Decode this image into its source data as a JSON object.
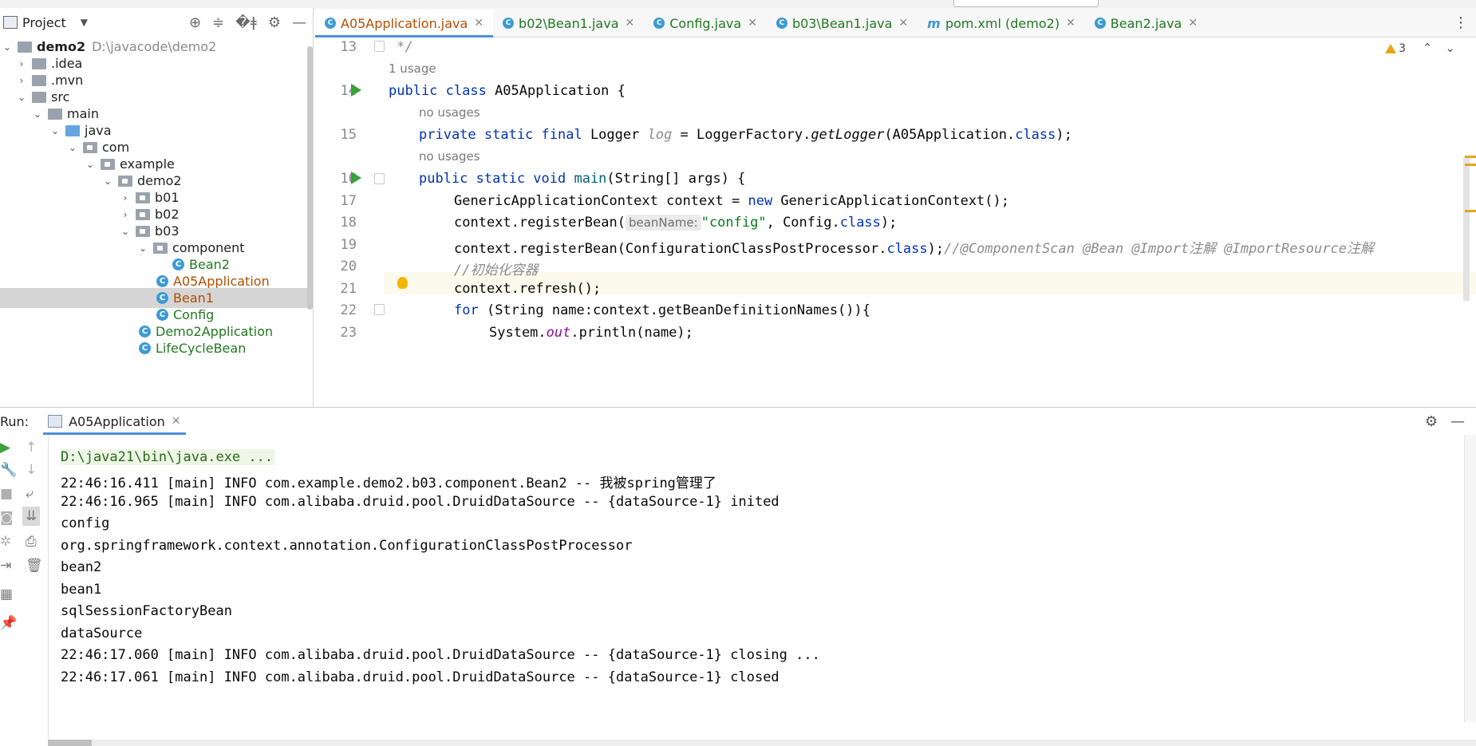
{
  "project": {
    "title": "Project",
    "tree": [
      {
        "label": "demo2",
        "path": "D:\\javacode\\demo2",
        "bold": true
      },
      {
        "label": ".idea"
      },
      {
        "label": ".mvn"
      },
      {
        "label": "src"
      },
      {
        "label": "main"
      },
      {
        "label": "java"
      },
      {
        "label": "com"
      },
      {
        "label": "example"
      },
      {
        "label": "demo2"
      },
      {
        "label": "b01"
      },
      {
        "label": "b02"
      },
      {
        "label": "b03"
      },
      {
        "label": "component"
      },
      {
        "label": "Bean2"
      },
      {
        "label": "A05Application"
      },
      {
        "label": "Bean1"
      },
      {
        "label": "Config"
      },
      {
        "label": "Demo2Application"
      },
      {
        "label": "LifeCycleBean"
      }
    ]
  },
  "tabs": [
    {
      "label": "A05Application.java"
    },
    {
      "label": "b02\\Bean1.java"
    },
    {
      "label": "Config.java"
    },
    {
      "label": "b03\\Bean1.java"
    },
    {
      "label": "pom.xml (demo2)"
    },
    {
      "label": "Bean2.java"
    }
  ],
  "editor": {
    "warning_count": "3",
    "line_numbers": [
      "13",
      "14",
      "15",
      "16",
      "17",
      "18",
      "19",
      "20",
      "21",
      "22",
      "23"
    ],
    "hints": {
      "h1": "1 usage",
      "h2": "no usages",
      "h3": "no usages"
    },
    "code": {
      "l13": " */",
      "l14_kw": "public class ",
      "l14_rest": "A05Application {",
      "l15_kw": "private static final ",
      "l15_a": "Logger ",
      "l15_field": "log",
      "l15_b": " = LoggerFactory.",
      "l15_fn": "getLogger",
      "l15_c": "(A05Application.",
      "l15_kw2": "class",
      "l15_d": ");",
      "l16_kw": "public static void ",
      "l16_fn": "main",
      "l16_rest": "(String[] args) {",
      "l17_a": "GenericApplicationContext context = ",
      "l17_kw": "new",
      "l17_b": " GenericApplicationContext();",
      "l18_a": "context.registerBean(",
      "l18_inlay": "beanName:",
      "l18_str": "\"config\"",
      "l18_b": ", Config.",
      "l18_kw": "class",
      "l18_c": ");",
      "l19_a": "context.registerBean(ConfigurationClassPostProcessor.",
      "l19_kw": "class",
      "l19_b": ");",
      "l19_cm": "//@ComponentScan @Bean @Import注解 @ImportResource注解",
      "l20_cm": "//初始化容器",
      "l21": "context.refresh();",
      "l22_kw": "for",
      "l22_rest": " (String name:context.getBeanDefinitionNames()){",
      "l23_a": "System.",
      "l23_field": "out",
      "l23_b": ".println(name);"
    }
  },
  "run": {
    "label": "Run:",
    "tab": "A05Application",
    "console": [
      "D:\\java21\\bin\\java.exe ...",
      "22:46:16.411 [main] INFO com.example.demo2.b03.component.Bean2 -- 我被spring管理了",
      "22:46:16.965 [main] INFO com.alibaba.druid.pool.DruidDataSource -- {dataSource-1} inited",
      "config",
      "org.springframework.context.annotation.ConfigurationClassPostProcessor",
      "bean2",
      "bean1",
      "sqlSessionFactoryBean",
      "dataSource",
      "22:46:17.060 [main] INFO com.alibaba.druid.pool.DruidDataSource -- {dataSource-1} closing ...",
      "22:46:17.061 [main] INFO com.alibaba.druid.pool.DruidDataSource -- {dataSource-1} closed"
    ]
  },
  "colors": {
    "keyword": "#0033b3",
    "string": "#067d17",
    "comment": "#8c8c8c",
    "modified_file": "#b34e00",
    "vcs_added": "#217a21",
    "accent": "#4e8ede"
  }
}
